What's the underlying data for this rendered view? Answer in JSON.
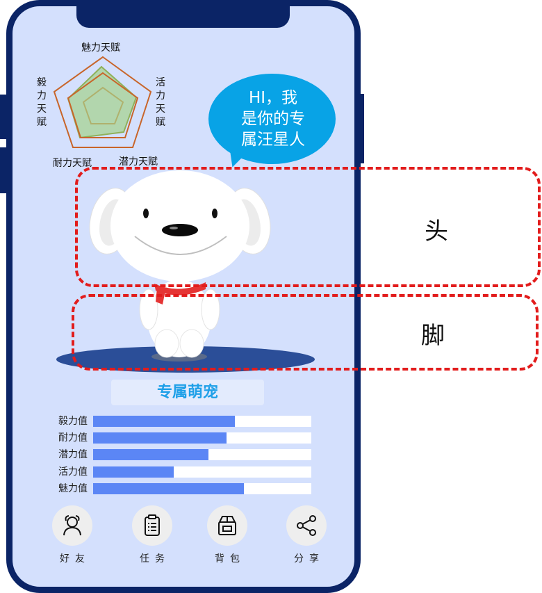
{
  "radar": {
    "labels": {
      "charm": "魅力天赋",
      "vitality": "活力天赋",
      "potential": "潜力天赋",
      "endurance": "耐力天赋",
      "perseverance": "毅力天赋"
    }
  },
  "bubble": {
    "line1": "HI，我",
    "line2": "是你的专",
    "line3": "属汪星人"
  },
  "annotations": {
    "head": "头",
    "foot": "脚"
  },
  "pet": {
    "title": "专属萌宠"
  },
  "stats": [
    {
      "label": "毅力值",
      "fraction": 0.65
    },
    {
      "label": "耐力值",
      "fraction": 0.61
    },
    {
      "label": "潜力值",
      "fraction": 0.53
    },
    {
      "label": "活力值",
      "fraction": 0.37
    },
    {
      "label": "魅力值",
      "fraction": 0.69
    }
  ],
  "nav": [
    {
      "label": "好友",
      "icon": "friends-icon"
    },
    {
      "label": "任务",
      "icon": "task-list-icon"
    },
    {
      "label": "背包",
      "icon": "backpack-box-icon"
    },
    {
      "label": "分享",
      "icon": "share-icon"
    }
  ],
  "colors": {
    "phone_frame": "#0b2466",
    "screen_bg": "#d4e0fd",
    "bubble": "#08a3e6",
    "bar_fill": "#5b86f5",
    "dash": "#e21c1c",
    "title_text": "#1fa0e8"
  }
}
